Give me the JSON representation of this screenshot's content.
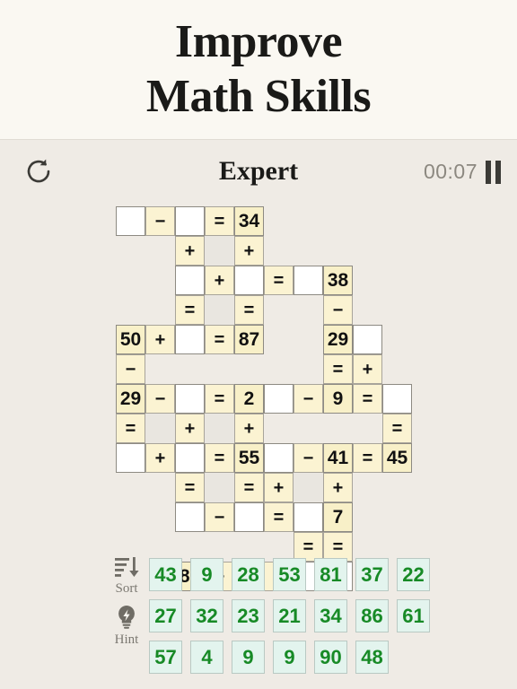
{
  "header": {
    "line1": "Improve",
    "line2": "Math Skills"
  },
  "toolbar": {
    "refresh_icon": "refresh-icon",
    "level": "Expert",
    "timer": "00:07",
    "pause_icon": "pause-icon"
  },
  "grid": {
    "cols": 10,
    "rows": 12,
    "cell_size": 33,
    "cells": [
      {
        "r": 0,
        "c": 0,
        "type": "blank",
        "text": ""
      },
      {
        "r": 0,
        "c": 1,
        "type": "op",
        "text": "−"
      },
      {
        "r": 0,
        "c": 2,
        "type": "blank",
        "text": ""
      },
      {
        "r": 0,
        "c": 3,
        "type": "op",
        "text": "="
      },
      {
        "r": 0,
        "c": 4,
        "type": "num",
        "text": "34"
      },
      {
        "r": 1,
        "c": 2,
        "type": "op",
        "text": "+"
      },
      {
        "r": 1,
        "c": 3,
        "type": "shade",
        "text": ""
      },
      {
        "r": 1,
        "c": 4,
        "type": "op",
        "text": "+"
      },
      {
        "r": 2,
        "c": 2,
        "type": "blank",
        "text": ""
      },
      {
        "r": 2,
        "c": 3,
        "type": "op",
        "text": "+"
      },
      {
        "r": 2,
        "c": 4,
        "type": "blank",
        "text": ""
      },
      {
        "r": 2,
        "c": 5,
        "type": "op",
        "text": "="
      },
      {
        "r": 2,
        "c": 6,
        "type": "blank",
        "text": ""
      },
      {
        "r": 2,
        "c": 7,
        "type": "num",
        "text": "38"
      },
      {
        "r": 3,
        "c": 2,
        "type": "op",
        "text": "="
      },
      {
        "r": 3,
        "c": 3,
        "type": "shade",
        "text": ""
      },
      {
        "r": 3,
        "c": 4,
        "type": "op",
        "text": "="
      },
      {
        "r": 3,
        "c": 7,
        "type": "op",
        "text": "−"
      },
      {
        "r": 4,
        "c": 0,
        "type": "num",
        "text": "50"
      },
      {
        "r": 4,
        "c": 1,
        "type": "op",
        "text": "+"
      },
      {
        "r": 4,
        "c": 2,
        "type": "blank",
        "text": ""
      },
      {
        "r": 4,
        "c": 3,
        "type": "op",
        "text": "="
      },
      {
        "r": 4,
        "c": 4,
        "type": "num",
        "text": "87"
      },
      {
        "r": 4,
        "c": 7,
        "type": "num",
        "text": "29"
      },
      {
        "r": 4,
        "c": 8,
        "type": "blank",
        "text": ""
      },
      {
        "r": 5,
        "c": 0,
        "type": "op",
        "text": "−"
      },
      {
        "r": 5,
        "c": 7,
        "type": "op",
        "text": "="
      },
      {
        "r": 5,
        "c": 8,
        "type": "op",
        "text": "+"
      },
      {
        "r": 6,
        "c": 0,
        "type": "num",
        "text": "29"
      },
      {
        "r": 6,
        "c": 1,
        "type": "op",
        "text": "−"
      },
      {
        "r": 6,
        "c": 2,
        "type": "blank",
        "text": ""
      },
      {
        "r": 6,
        "c": 3,
        "type": "op",
        "text": "="
      },
      {
        "r": 6,
        "c": 4,
        "type": "num",
        "text": "2"
      },
      {
        "r": 6,
        "c": 5,
        "type": "blank",
        "text": ""
      },
      {
        "r": 6,
        "c": 6,
        "type": "op",
        "text": "−"
      },
      {
        "r": 6,
        "c": 7,
        "type": "num",
        "text": "9"
      },
      {
        "r": 6,
        "c": 8,
        "type": "op",
        "text": "="
      },
      {
        "r": 6,
        "c": 9,
        "type": "blank",
        "text": ""
      },
      {
        "r": 7,
        "c": 0,
        "type": "op",
        "text": "="
      },
      {
        "r": 7,
        "c": 1,
        "type": "shade",
        "text": ""
      },
      {
        "r": 7,
        "c": 2,
        "type": "op",
        "text": "+"
      },
      {
        "r": 7,
        "c": 3,
        "type": "shade",
        "text": ""
      },
      {
        "r": 7,
        "c": 4,
        "type": "op",
        "text": "+"
      },
      {
        "r": 7,
        "c": 9,
        "type": "op",
        "text": "="
      },
      {
        "r": 8,
        "c": 0,
        "type": "blank",
        "text": ""
      },
      {
        "r": 8,
        "c": 1,
        "type": "op",
        "text": "+"
      },
      {
        "r": 8,
        "c": 2,
        "type": "blank",
        "text": ""
      },
      {
        "r": 8,
        "c": 3,
        "type": "op",
        "text": "="
      },
      {
        "r": 8,
        "c": 4,
        "type": "num",
        "text": "55"
      },
      {
        "r": 8,
        "c": 5,
        "type": "blank",
        "text": ""
      },
      {
        "r": 8,
        "c": 6,
        "type": "op",
        "text": "−"
      },
      {
        "r": 8,
        "c": 7,
        "type": "num",
        "text": "41"
      },
      {
        "r": 8,
        "c": 8,
        "type": "op",
        "text": "="
      },
      {
        "r": 8,
        "c": 9,
        "type": "num",
        "text": "45"
      },
      {
        "r": 9,
        "c": 2,
        "type": "op",
        "text": "="
      },
      {
        "r": 9,
        "c": 3,
        "type": "shade",
        "text": ""
      },
      {
        "r": 9,
        "c": 4,
        "type": "op",
        "text": "="
      },
      {
        "r": 9,
        "c": 5,
        "type": "op",
        "text": "+"
      },
      {
        "r": 9,
        "c": 6,
        "type": "shade",
        "text": ""
      },
      {
        "r": 9,
        "c": 7,
        "type": "op",
        "text": "+"
      },
      {
        "r": 10,
        "c": 2,
        "type": "blank",
        "text": ""
      },
      {
        "r": 10,
        "c": 3,
        "type": "op",
        "text": "−"
      },
      {
        "r": 10,
        "c": 4,
        "type": "blank",
        "text": ""
      },
      {
        "r": 10,
        "c": 5,
        "type": "op",
        "text": "="
      },
      {
        "r": 10,
        "c": 6,
        "type": "blank",
        "text": ""
      },
      {
        "r": 10,
        "c": 7,
        "type": "num",
        "text": "7"
      },
      {
        "r": 11,
        "c": 6,
        "type": "op",
        "text": "="
      },
      {
        "r": 11,
        "c": 7,
        "type": "op",
        "text": "="
      },
      {
        "r": 12,
        "c": 2,
        "type": "num",
        "text": "81"
      },
      {
        "r": 12,
        "c": 3,
        "type": "op",
        "text": "+"
      },
      {
        "r": 12,
        "c": 4,
        "type": "blank",
        "text": ""
      },
      {
        "r": 12,
        "c": 5,
        "type": "op",
        "text": "="
      },
      {
        "r": 12,
        "c": 6,
        "type": "blank",
        "text": ""
      },
      {
        "r": 12,
        "c": 7,
        "type": "blank",
        "text": ""
      }
    ]
  },
  "tray": {
    "sort_label": "Sort",
    "sort_icon": "sort-icon",
    "hint_label": "Hint",
    "hint_icon": "lightbulb-icon",
    "tile_rows": [
      [
        "43",
        "9",
        "28",
        "53",
        "81",
        "37",
        "22"
      ],
      [
        "27",
        "32",
        "23",
        "21",
        "34",
        "86",
        "61"
      ],
      [
        "57",
        "4",
        "9",
        "9",
        "90",
        "48"
      ]
    ]
  },
  "colors": {
    "page_bg": "#efebe5",
    "header_bg": "#faf8f2",
    "num_cell": "#f8f0c8",
    "op_cell": "#fbf3d2",
    "blank_cell": "#ffffff",
    "tile_bg": "#e3f4ee",
    "tile_text": "#178a26"
  }
}
